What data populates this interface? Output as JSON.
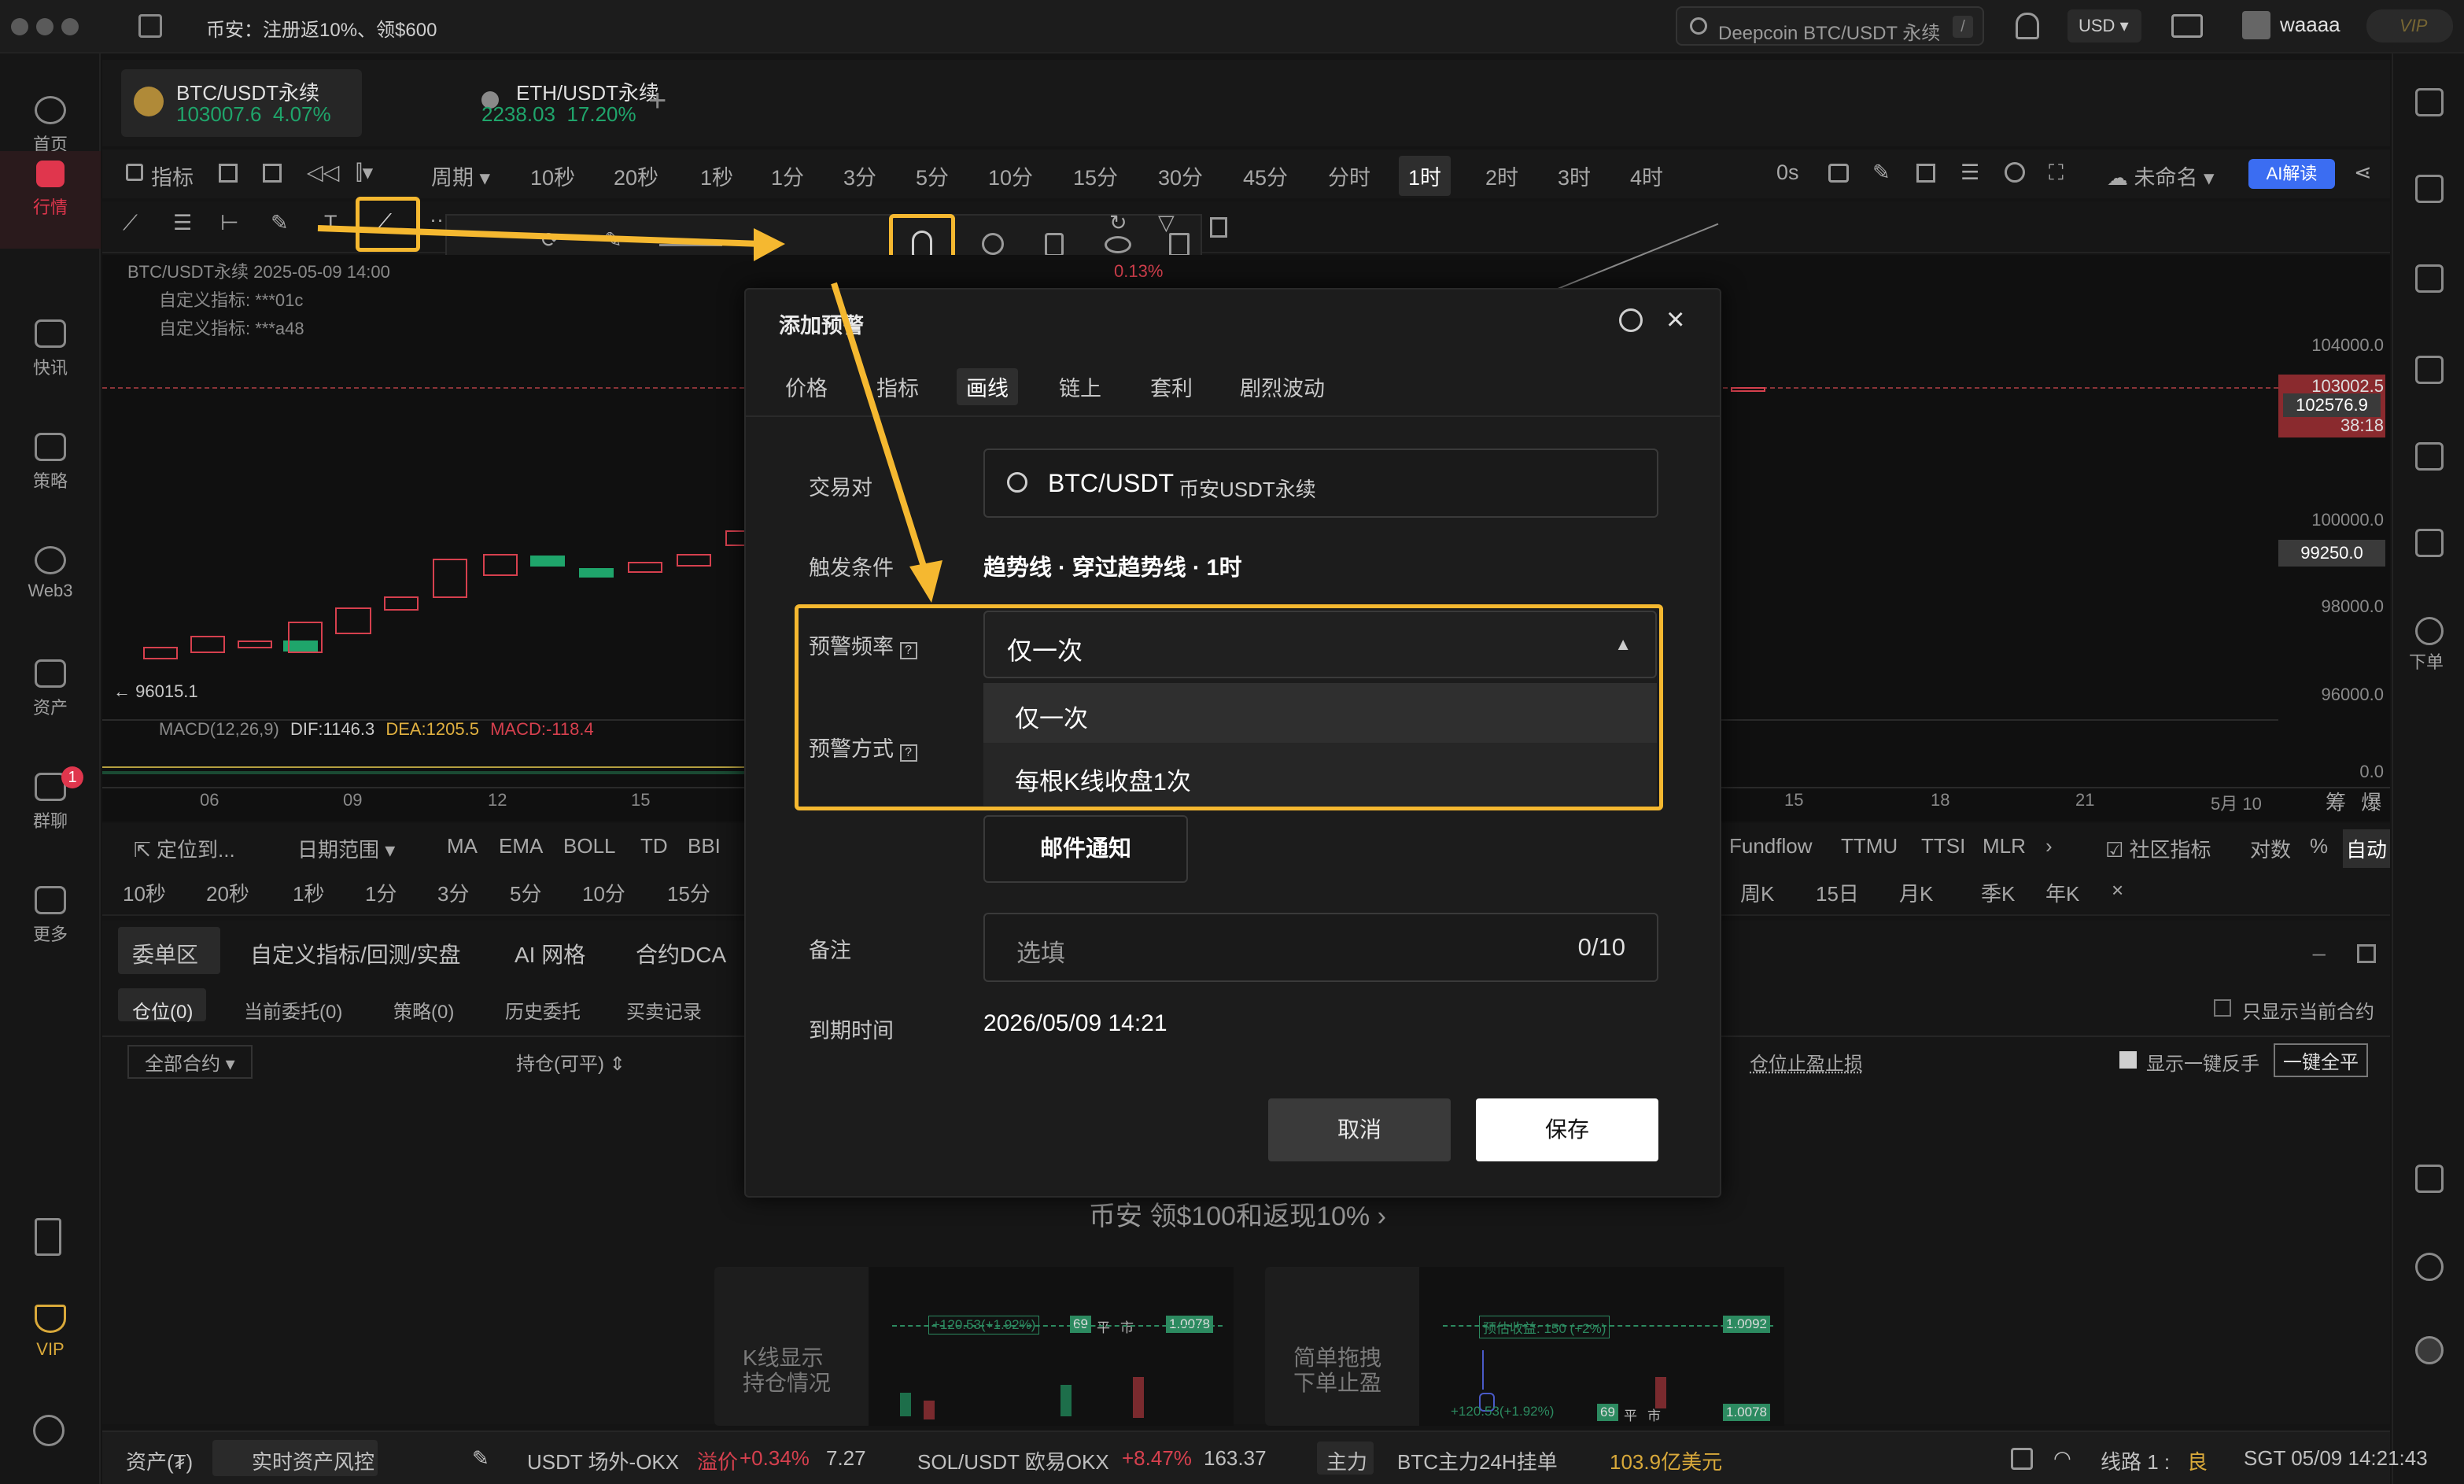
{
  "topbar": {
    "banner": "币安：注册返10%、领$600",
    "search_placeholder": "Deepcoin BTC/USDT 永续",
    "search_shortcut": "/",
    "currency": "USD",
    "username": "waaaa",
    "vip": "VIP"
  },
  "left_nav": [
    "首页",
    "行情",
    "快讯",
    "策略",
    "Web3",
    "资产",
    "群聊",
    "更多",
    "VIP"
  ],
  "group_chat_badge": "1",
  "symbol_tabs": [
    {
      "name": "BTC/USDT永续",
      "price": "103007.6",
      "change": "4.07%"
    },
    {
      "name": "ETH/USDT永续",
      "price": "2238.03",
      "change": "17.20%"
    }
  ],
  "timeframes": [
    "指标",
    "周期",
    "10秒",
    "20秒",
    "1秒",
    "1分",
    "3分",
    "5分",
    "10分",
    "15分",
    "30分",
    "45分",
    "分时",
    "1时",
    "2时",
    "3时",
    "4时"
  ],
  "toolbar_right": {
    "countdown": "0s",
    "layout_name": "未命名",
    "ai": "AI解读"
  },
  "chart": {
    "overlay_symbol": "BTC/USDT永续  2025-05-09 14:00",
    "custom_ind_1": "自定义指标: ***01c",
    "custom_ind_2": "自定义指标: ***a48",
    "change_pct": "0.13%",
    "low_label": "96015.1",
    "macd_label": "MACD(12,26,9)",
    "dif": "DIF:1146.3",
    "dea": "DEA:1205.5",
    "macd_val": "MACD:-118.4",
    "price_axis": [
      "104000.0",
      "103002.5",
      "102576.9",
      "38:18",
      "100000.0",
      "99250.0",
      "98000.0",
      "96000.0",
      "0.0"
    ],
    "x_axis": [
      "06",
      "09",
      "12",
      "15",
      "15",
      "18",
      "21",
      "5月 10"
    ],
    "axis_corner": [
      "筹",
      "爆"
    ]
  },
  "indicator_bar_left": [
    "定位到...",
    "日期范围",
    "MA",
    "EMA",
    "BOLL",
    "TD",
    "BBI"
  ],
  "indicator_bar_right": [
    "Fundflow",
    "TTMU",
    "TTSI",
    "MLR",
    "社区指标",
    "对数",
    "%",
    "自动"
  ],
  "interval_bar_left": [
    "10秒",
    "20秒",
    "1秒",
    "1分",
    "3分",
    "5分",
    "10分",
    "15分"
  ],
  "interval_bar_right": [
    "周K",
    "15日",
    "月K",
    "季K",
    "年K"
  ],
  "bottom_tabs": [
    "委单区",
    "自定义指标/回测/实盘",
    "AI 网格",
    "合约DCA"
  ],
  "order_tabs": [
    "仓位(0)",
    "当前委托(0)",
    "策略(0)",
    "历史委托",
    "买卖记录"
  ],
  "order_filters": {
    "all_contracts": "全部合约",
    "position_col": "持仓(可平)",
    "pnl_col": "仓位止盈止损",
    "only_current": "只显示当前合约",
    "show_reverse": "显示一键反手",
    "close_all": "一键全平"
  },
  "promo": {
    "headline": "币安 领$100和返现10%",
    "card1_title": "K线显示\n持仓情况",
    "card2_title": "简单拖拽\n下单止盈",
    "card1_labels": [
      "+120.53(+1.92%)",
      "69",
      "平",
      "市",
      "1.0078"
    ],
    "card2_labels": [
      "预估收益: 150 (+2%)",
      "1.0092",
      "+120.53(+1.92%)",
      "69",
      "平",
      "市",
      "1.0078"
    ]
  },
  "status_bar": {
    "assets": "资产(₮)",
    "risk": "实时资产风控",
    "usdt_otc": "USDT 场外-OKX",
    "premium_label": "溢价",
    "premium": "+0.34%",
    "usdt_price": "7.27",
    "sol": "SOL/USDT 欧易OKX",
    "sol_change": "+8.47%",
    "sol_price": "163.37",
    "main_force": "主力",
    "btc_main": "BTC主力24H挂单",
    "btc_main_val": "103.9亿美元",
    "route": "线路 1 :",
    "route_quality": "良",
    "time": "SGT 05/09 14:21:43"
  },
  "right_sidebar_label": "下单",
  "modal": {
    "title": "添加预警",
    "tabs": [
      "价格",
      "指标",
      "画线",
      "链上",
      "套利",
      "剧烈波动"
    ],
    "active_tab": "画线",
    "pair_label": "交易对",
    "pair_value": "BTC/USDT",
    "pair_sub": "币安USDT永续",
    "trigger_label": "触发条件",
    "trigger_value": "趋势线 · 穿过趋势线 · 1时",
    "freq_label": "预警频率",
    "freq_selected": "仅一次",
    "freq_options": [
      "仅一次",
      "每根K线收盘1次"
    ],
    "method_label": "预警方式",
    "method_email": "邮件通知",
    "note_label": "备注",
    "note_placeholder": "选填",
    "note_count": "0/10",
    "expiry_label": "到期时间",
    "expiry_value": "2026/05/09 14:21",
    "cancel": "取消",
    "save": "保存"
  },
  "colors": {
    "highlight": "#f5b830",
    "up": "#1fa56b",
    "down": "#d6404e",
    "accent": "#e0364d",
    "ai": "#3b6df2"
  }
}
